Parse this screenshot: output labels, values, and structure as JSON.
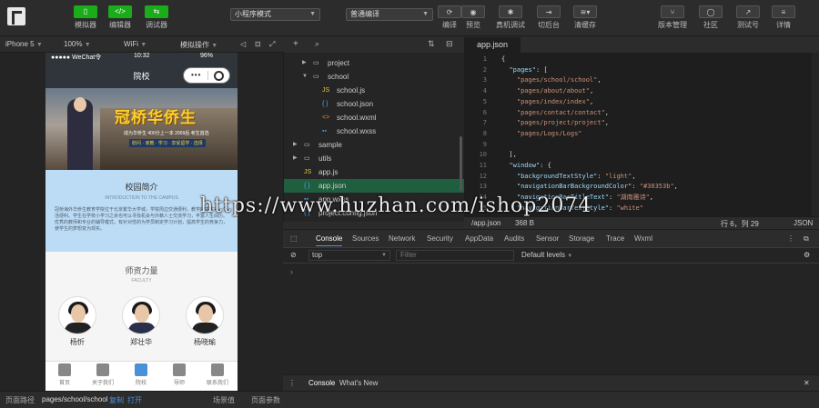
{
  "toolbar": {
    "simulator": "模拟器",
    "editor": "编辑器",
    "debugger": "调试器",
    "mode_select": "小程序模式",
    "compile_select": "普通编译",
    "compile": "编译",
    "preview": "预览",
    "real_debug": "真机调试",
    "switch_bg": "切后台",
    "clear_cache": "清缓存",
    "version_mgmt": "版本管理",
    "community": "社区",
    "test_account": "测试号",
    "details": "详情"
  },
  "device_bar": {
    "device": "iPhone 5",
    "zoom": "100%",
    "network": "WiFi",
    "simulate_op": "模拟操作"
  },
  "phone": {
    "carrier": "●●●●● WeChat令",
    "time": "10:32",
    "battery": "96%",
    "nav_title": "院校",
    "capsule_dots": "•••",
    "banner_title": "冠桥华侨生",
    "banner_sub": "成为华侨生 400分上一本 2009后 考生首选",
    "banner_tags": "慰问 · 家教 · 学习 · 享受留学 · 选择",
    "intro_title": "校园简介",
    "intro_en": "INTRODUCTION TO THE CAMPUS",
    "intro_text": "冠桥海外华侨生教育学院位于北京繁华大学城，学院周边交通便利，教学环境优美，生活便利。学生在学校小学习之余也可以寻找机会与外籍人士交流学习，丰富人生阅历。优秀的教师和专业的辅导模式，有针对性的为学员制定学习计划，提高学生的竞争力，使学生的梦想变为现实。",
    "teachers_title": "师资力量",
    "teachers_en": "FACULTY",
    "teachers": [
      {
        "name": "杨忻"
      },
      {
        "name": "郑壮华"
      },
      {
        "name": "杨晓瑜"
      }
    ],
    "tabs": [
      {
        "label": "首页"
      },
      {
        "label": "关于我们"
      },
      {
        "label": "院校"
      },
      {
        "label": "导师"
      },
      {
        "label": "联系我们"
      }
    ]
  },
  "tree": {
    "rows": [
      {
        "type": "folder",
        "name": "project",
        "indent": 1,
        "open": false
      },
      {
        "type": "folder",
        "name": "school",
        "indent": 1,
        "open": true
      },
      {
        "type": "js",
        "name": "school.js",
        "indent": 2
      },
      {
        "type": "json",
        "name": "school.json",
        "indent": 2
      },
      {
        "type": "wxml",
        "name": "school.wxml",
        "indent": 2
      },
      {
        "type": "wxss",
        "name": "school.wxss",
        "indent": 2
      },
      {
        "type": "folder",
        "name": "sample",
        "indent": 0,
        "open": false
      },
      {
        "type": "folder",
        "name": "utils",
        "indent": 0,
        "open": false
      },
      {
        "type": "js",
        "name": "app.js",
        "indent": 0
      },
      {
        "type": "json",
        "name": "app.json",
        "indent": 0,
        "selected": true
      },
      {
        "type": "wxss",
        "name": "app.wxss",
        "indent": 0
      },
      {
        "type": "json",
        "name": "project.config.json",
        "indent": 0
      }
    ]
  },
  "editor": {
    "tab": "app.json",
    "lines": [
      {
        "n": "1",
        "text": "{"
      },
      {
        "n": "2",
        "text": "  \"pages\": ["
      },
      {
        "n": "3",
        "text": "    \"pages/school/school\","
      },
      {
        "n": "4",
        "text": "    \"pages/about/about\","
      },
      {
        "n": "5",
        "text": "    \"pages/index/index\","
      },
      {
        "n": "6",
        "text": "    \"pages/contact/contact\","
      },
      {
        "n": "7",
        "text": "    \"pages/project/project\","
      },
      {
        "n": "8",
        "text": "    \"pages/Logs/Logs\""
      },
      {
        "n": "9",
        "text": ""
      },
      {
        "n": "10",
        "text": "  ],"
      },
      {
        "n": "11",
        "text": "  \"window\": {"
      },
      {
        "n": "12",
        "text": "    \"backgroundTextStyle\": \"light\","
      },
      {
        "n": "13",
        "text": "    \"navigationBarBackgroundColor\": \"#30353b\","
      },
      {
        "n": "14",
        "text": "    \"navigationBarTitleText\": \"湖南雅诗\","
      },
      {
        "n": "15",
        "text": "    \"navigationBarTextStyle\": \"white\""
      }
    ],
    "status_file": "/app.json",
    "status_size": "368 B",
    "status_pos": "行 6，列 29",
    "status_lang": "JSON"
  },
  "devtools": {
    "tabs": [
      "Console",
      "Sources",
      "Network",
      "Security",
      "AppData",
      "Audits",
      "Sensor",
      "Storage",
      "Trace",
      "Wxml"
    ],
    "context": "top",
    "filter_placeholder": "Filter",
    "levels": "Default levels",
    "prompt": "›"
  },
  "drawer": {
    "console": "Console",
    "whats_new": "What's New"
  },
  "bottom": {
    "path_label": "页面路径",
    "path": "pages/school/school",
    "copy": "复制",
    "open": "打开",
    "scene": "场景值",
    "params": "页面参数"
  },
  "watermark": "https://www.huzhan.com/ishop2074"
}
